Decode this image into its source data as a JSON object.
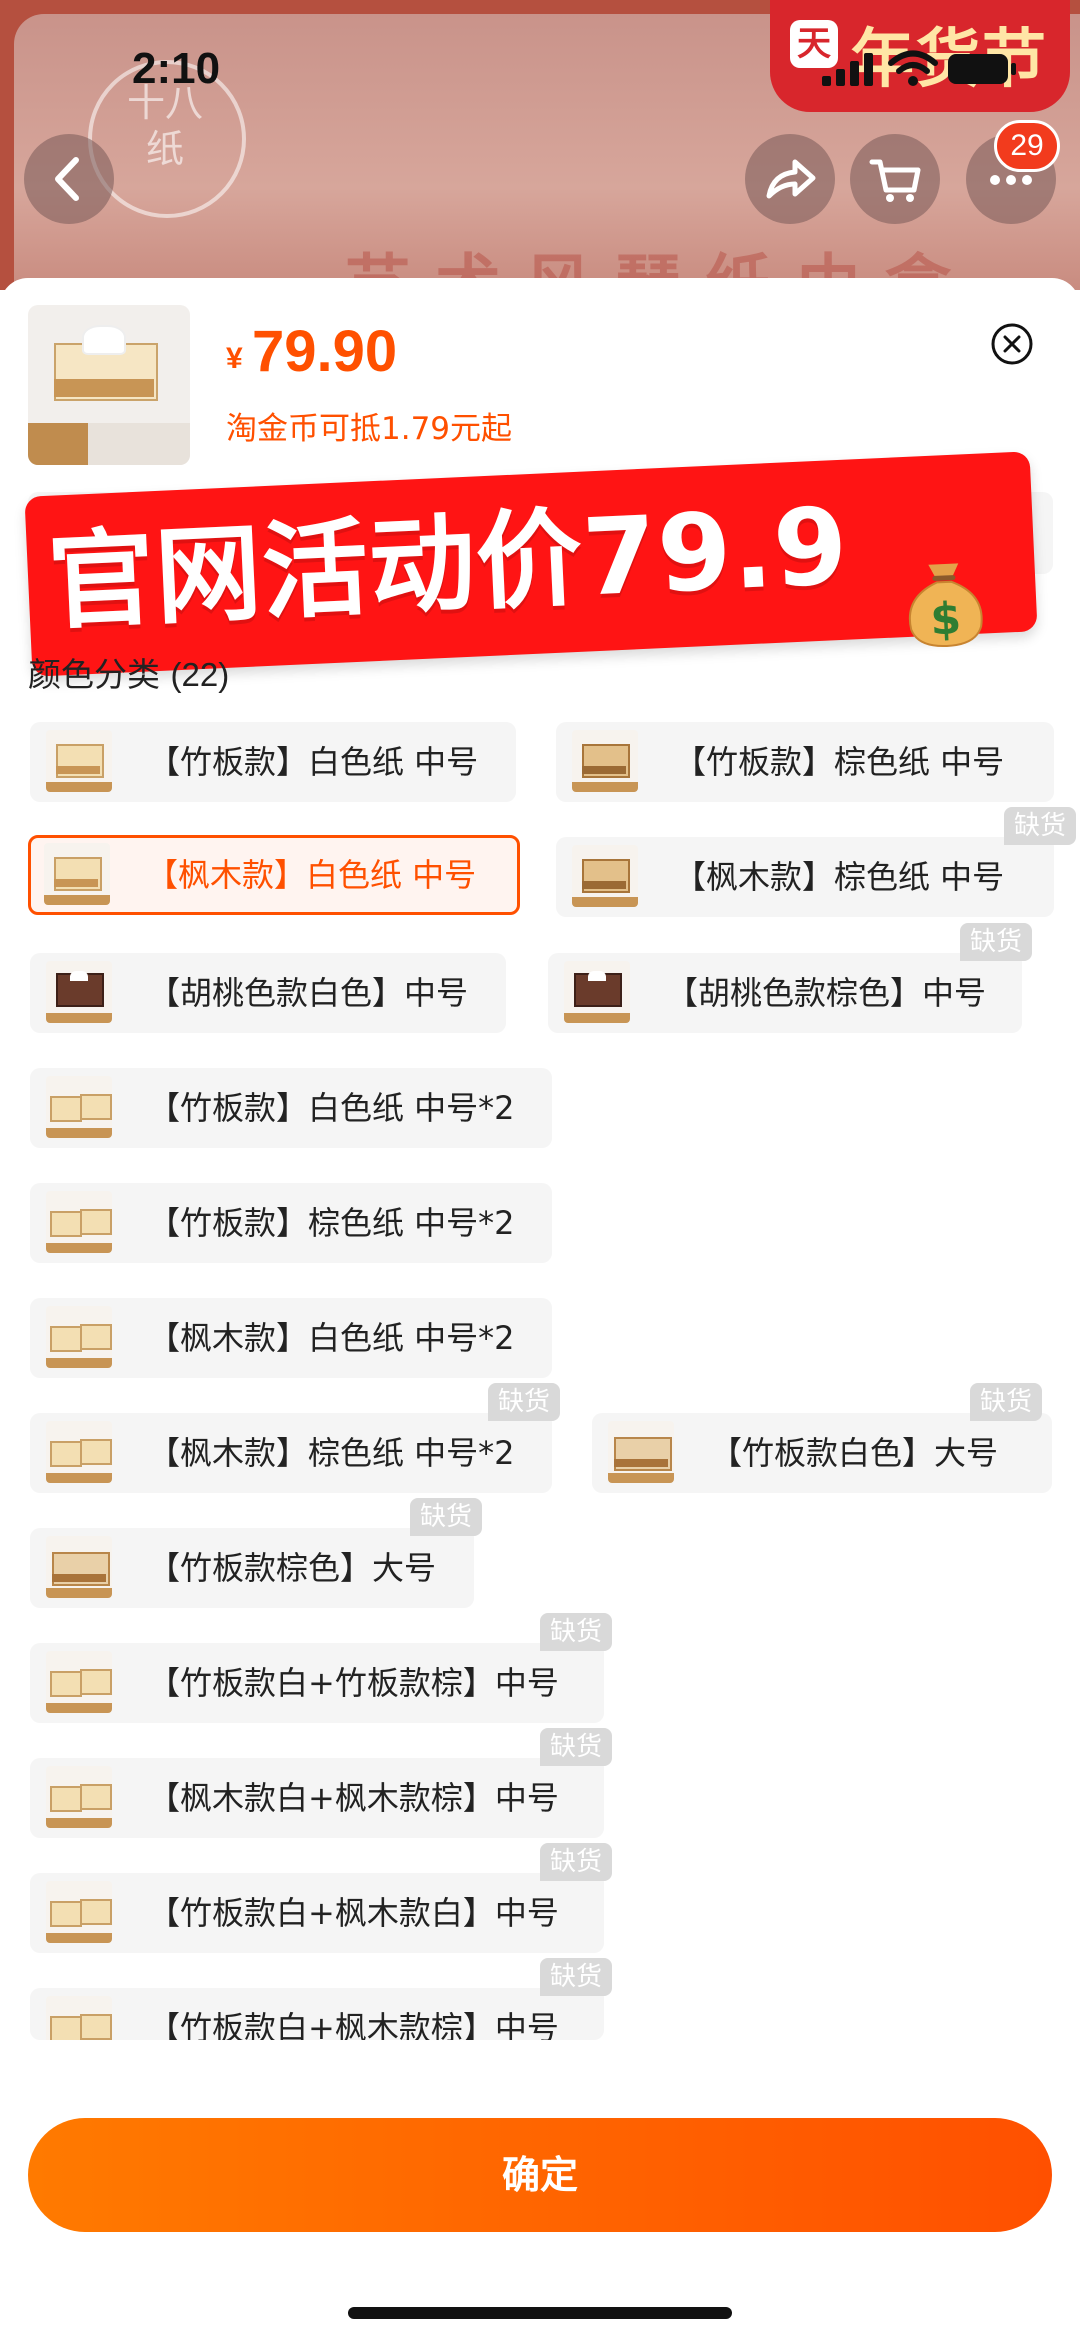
{
  "status_bar": {
    "time": "2:10"
  },
  "background": {
    "logo_text": "十八纸",
    "banner_text": "艺术风琴纸巾盒",
    "festival_tmall": "天",
    "festival_label": "年货节"
  },
  "nav": {
    "cart_badge": "29"
  },
  "product": {
    "price_symbol": "¥",
    "price": "79.90",
    "coin_note": "淘金币可抵1.79元起"
  },
  "promo": {
    "text": "官网活动价79.9",
    "emoji": "💰"
  },
  "options": {
    "title": "颜色分类",
    "count": "(22)",
    "out_of_stock_label": "缺货",
    "items": [
      {
        "label": "【竹板款】白色纸 中号",
        "oos": false,
        "selected": false
      },
      {
        "label": "【竹板款】棕色纸 中号",
        "oos": false,
        "selected": false
      },
      {
        "label": "【枫木款】白色纸 中号",
        "oos": false,
        "selected": true
      },
      {
        "label": "【枫木款】棕色纸 中号",
        "oos": true,
        "selected": false
      },
      {
        "label": "【胡桃色款白色】中号",
        "oos": false,
        "selected": false
      },
      {
        "label": "【胡桃色款棕色】中号",
        "oos": true,
        "selected": false
      },
      {
        "label": "【竹板款】白色纸 中号*2",
        "oos": false,
        "selected": false
      },
      {
        "label": "【竹板款】棕色纸 中号*2",
        "oos": false,
        "selected": false
      },
      {
        "label": "【枫木款】白色纸 中号*2",
        "oos": false,
        "selected": false
      },
      {
        "label": "【枫木款】棕色纸 中号*2",
        "oos": true,
        "selected": false
      },
      {
        "label": "【竹板款白色】大号",
        "oos": true,
        "selected": false
      },
      {
        "label": "【竹板款棕色】大号",
        "oos": true,
        "selected": false
      },
      {
        "label": "【竹板款白+竹板款棕】中号",
        "oos": true,
        "selected": false
      },
      {
        "label": "【枫木款白+枫木款棕】中号",
        "oos": true,
        "selected": false
      },
      {
        "label": "【竹板款白+枫木款白】中号",
        "oos": true,
        "selected": false
      },
      {
        "label": "【竹板款白+枫木款棕】中号",
        "oos": true,
        "selected": false
      }
    ]
  },
  "footer": {
    "confirm_label": "确定"
  }
}
